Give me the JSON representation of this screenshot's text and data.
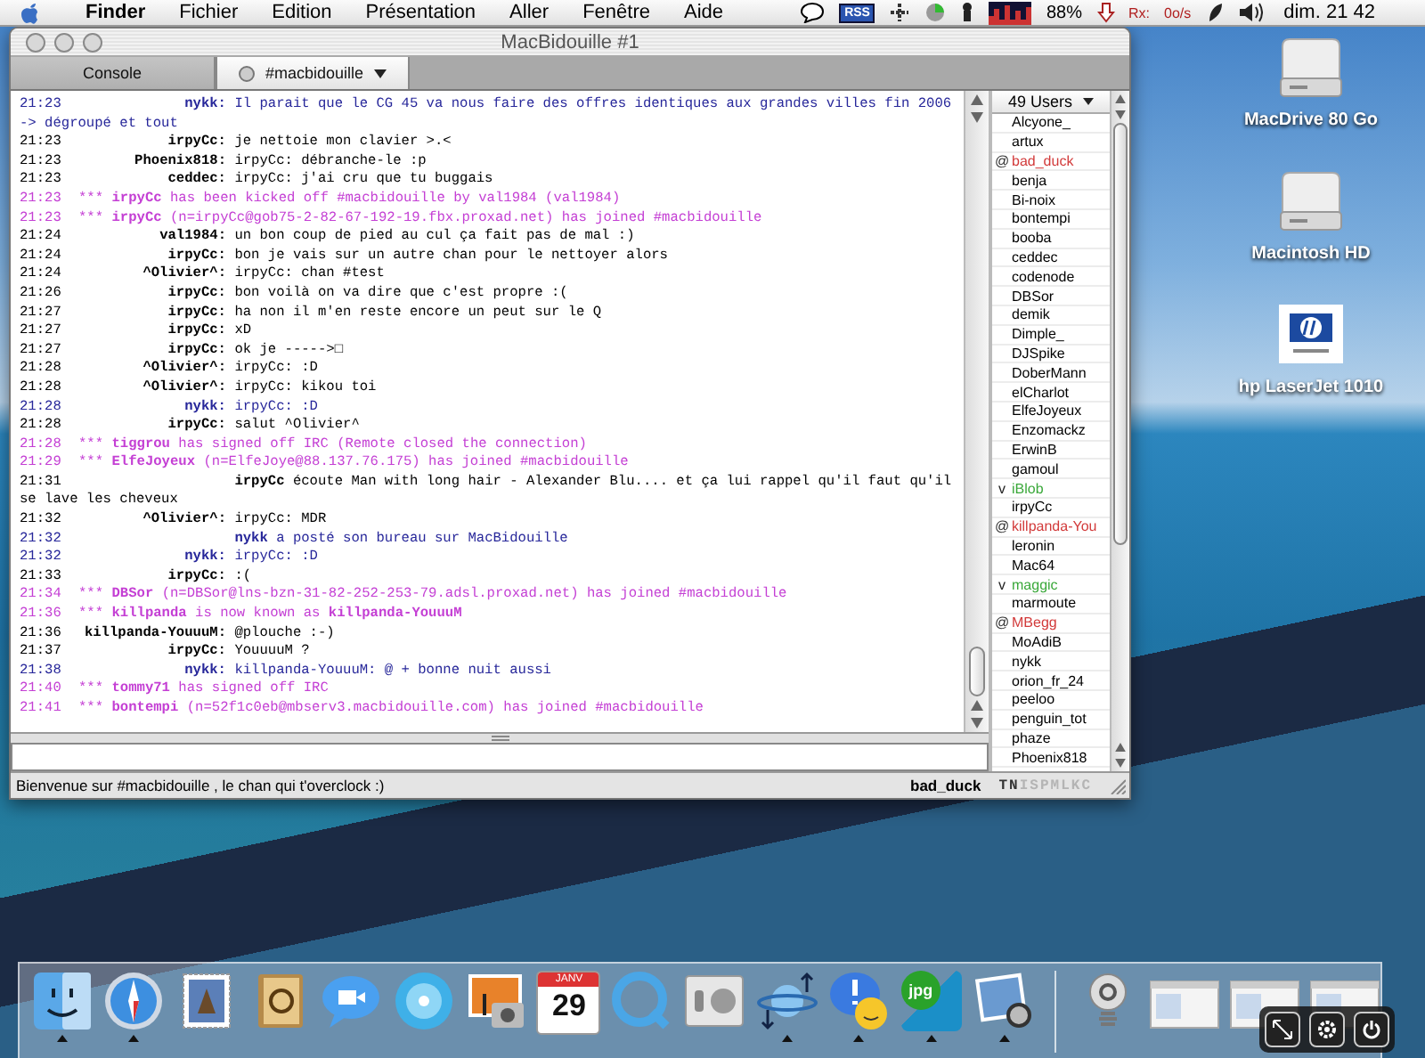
{
  "menu_bar": {
    "menus": [
      "Finder",
      "Fichier",
      "Edition",
      "Présentation",
      "Aller",
      "Fenêtre",
      "Aide"
    ],
    "rss": "RSS",
    "battery": "88%",
    "net_label": "Rx:",
    "net_rate": "0o/s",
    "clock": "dim. 21 42"
  },
  "window": {
    "title": "MacBidouille #1",
    "tabs": [
      {
        "label": "Console",
        "selected": false
      },
      {
        "label": "#macbidouille",
        "selected": true
      }
    ],
    "chat": [
      {
        "kind": "message",
        "time": "21:23",
        "nick": "nykk:",
        "text": "Il parait que le CG 45 va nous faire des offres identiques aux grandes villes fin 2006 -> dégroupé et tout",
        "color": "#27279a"
      },
      {
        "kind": "message",
        "time": "21:23",
        "nick": "irpyCc:",
        "text": "je nettoie mon clavier >.<",
        "color": "#000000"
      },
      {
        "kind": "message",
        "time": "21:23",
        "nick": "Phoenix818:",
        "text": "irpyCc: débranche-le :p",
        "color": "#000000"
      },
      {
        "kind": "message",
        "time": "21:23",
        "nick": "ceddec:",
        "text": "irpyCc: j'ai cru que tu buggais",
        "color": "#000000"
      },
      {
        "kind": "event",
        "time": "21:23",
        "marker": "***",
        "text": "**irpyCc** has been kicked off #macbidouille by val1984 (val1984)",
        "color": "#c43fd4"
      },
      {
        "kind": "event",
        "time": "21:23",
        "marker": "***",
        "text": "**irpyCc** (n=irpyCc@gob75-2-82-67-192-19.fbx.proxad.net) has joined #macbidouille",
        "color": "#c43fd4"
      },
      {
        "kind": "message",
        "time": "21:24",
        "nick": "val1984:",
        "text": "un bon coup de pied au cul ça fait pas de mal :)",
        "color": "#000000"
      },
      {
        "kind": "message",
        "time": "21:24",
        "nick": "irpyCc:",
        "text": "bon je vais sur un autre chan pour le nettoyer alors",
        "color": "#000000"
      },
      {
        "kind": "message",
        "time": "21:24",
        "nick": "^Olivier^:",
        "text": "irpyCc: chan #test",
        "color": "#000000"
      },
      {
        "kind": "message",
        "time": "21:26",
        "nick": "irpyCc:",
        "text": "bon voilà on va dire que c'est propre :(",
        "color": "#000000"
      },
      {
        "kind": "message",
        "time": "21:27",
        "nick": "irpyCc:",
        "text": "ha non il m'en reste encore un peut sur le Q",
        "color": "#000000"
      },
      {
        "kind": "message",
        "time": "21:27",
        "nick": "irpyCc:",
        "text": "xD",
        "color": "#000000"
      },
      {
        "kind": "message",
        "time": "21:27",
        "nick": "irpyCc:",
        "text": "ok je ----->□",
        "color": "#000000"
      },
      {
        "kind": "message",
        "time": "21:28",
        "nick": "^Olivier^:",
        "text": "irpyCc: :D",
        "color": "#000000"
      },
      {
        "kind": "message",
        "time": "21:28",
        "nick": "^Olivier^:",
        "text": "irpyCc: kikou toi",
        "color": "#000000"
      },
      {
        "kind": "message",
        "time": "21:28",
        "nick": "nykk:",
        "text": "irpyCc: :D",
        "color": "#27279a"
      },
      {
        "kind": "message",
        "time": "21:28",
        "nick": "irpyCc:",
        "text": "salut ^Olivier^",
        "color": "#000000"
      },
      {
        "kind": "event",
        "time": "21:28",
        "marker": "***",
        "text": "**tiggrou** has signed off IRC (Remote closed the connection)",
        "color": "#c43fd4"
      },
      {
        "kind": "event",
        "time": "21:29",
        "marker": "***",
        "text": "**ElfeJoyeux** (n=ElfeJoye@88.137.76.175) has joined #macbidouille",
        "color": "#c43fd4"
      },
      {
        "kind": "action",
        "time": "21:31",
        "nick": "irpyCc",
        "text": "écoute Man with long hair - Alexander Blu.... et ça lui rappel qu'il faut qu'il se lave les cheveux",
        "color": "#000000"
      },
      {
        "kind": "message",
        "time": "21:32",
        "nick": "^Olivier^:",
        "text": "irpyCc: MDR",
        "color": "#000000"
      },
      {
        "kind": "action",
        "time": "21:32",
        "nick": "nykk",
        "text": "a posté son bureau sur MacBidouille",
        "color": "#27279a"
      },
      {
        "kind": "message",
        "time": "21:32",
        "nick": "nykk:",
        "text": "irpyCc: :D",
        "color": "#27279a"
      },
      {
        "kind": "message",
        "time": "21:33",
        "nick": "irpyCc:",
        "text": ":(",
        "color": "#000000"
      },
      {
        "kind": "event",
        "time": "21:34",
        "marker": "***",
        "text": "**DBSor** (n=DBSor@lns-bzn-31-82-252-253-79.adsl.proxad.net) has joined #macbidouille",
        "color": "#c43fd4"
      },
      {
        "kind": "event",
        "time": "21:36",
        "marker": "***",
        "text": "**killpanda** is now known as **killpanda-YouuuM**",
        "color": "#c43fd4"
      },
      {
        "kind": "message",
        "time": "21:36",
        "nick": "killpanda-YouuuM:",
        "text": "@plouche :-)",
        "color": "#000000"
      },
      {
        "kind": "message",
        "time": "21:37",
        "nick": "irpyCc:",
        "text": "YouuuuM ?",
        "color": "#000000"
      },
      {
        "kind": "message",
        "time": "21:38",
        "nick": "nykk:",
        "text": "killpanda-YouuuM: @ + bonne nuit aussi",
        "color": "#27279a"
      },
      {
        "kind": "event",
        "time": "21:40",
        "marker": "***",
        "text": "**tommy71** has signed off IRC",
        "color": "#c43fd4"
      },
      {
        "kind": "event",
        "time": "21:41",
        "marker": "***",
        "text": "**bontempi** (n=52f1c0eb@mbserv3.macbidouille.com) has joined #macbidouille",
        "color": "#c43fd4"
      }
    ],
    "users": {
      "header": "49 Users",
      "items": [
        {
          "name": "Alcyone_",
          "color": "#000000"
        },
        {
          "name": "artux",
          "color": "#000000"
        },
        {
          "name": "bad_duck",
          "prefix": "@",
          "color": "#d23a3a"
        },
        {
          "name": "benja",
          "color": "#000000"
        },
        {
          "name": "Bi-noix",
          "color": "#000000"
        },
        {
          "name": "bontempi",
          "color": "#000000"
        },
        {
          "name": "booba",
          "color": "#000000"
        },
        {
          "name": "ceddec",
          "color": "#000000"
        },
        {
          "name": "codenode",
          "color": "#000000"
        },
        {
          "name": "DBSor",
          "color": "#000000"
        },
        {
          "name": "demik",
          "color": "#000000"
        },
        {
          "name": "Dimple_",
          "color": "#000000"
        },
        {
          "name": "DJSpike",
          "color": "#000000"
        },
        {
          "name": "DoberMann",
          "color": "#000000"
        },
        {
          "name": "elCharlot",
          "color": "#000000"
        },
        {
          "name": "ElfeJoyeux",
          "color": "#000000"
        },
        {
          "name": "Enzomackz",
          "color": "#000000"
        },
        {
          "name": "ErwinB",
          "color": "#000000"
        },
        {
          "name": "gamoul",
          "color": "#000000"
        },
        {
          "name": "iBlob",
          "prefix": "v",
          "color": "#3aa83a"
        },
        {
          "name": "irpyCc",
          "color": "#000000"
        },
        {
          "name": "killpanda-You",
          "prefix": "@",
          "color": "#d23a3a"
        },
        {
          "name": "leronin",
          "color": "#000000"
        },
        {
          "name": "Mac64",
          "color": "#000000"
        },
        {
          "name": "maggic",
          "prefix": "v",
          "color": "#3aa83a"
        },
        {
          "name": "marmoute",
          "color": "#000000"
        },
        {
          "name": "MBegg",
          "prefix": "@",
          "color": "#d23a3a"
        },
        {
          "name": "MoAdiB",
          "color": "#000000"
        },
        {
          "name": "nykk",
          "color": "#000000"
        },
        {
          "name": "orion_fr_24",
          "color": "#000000"
        },
        {
          "name": "peeloo",
          "color": "#000000"
        },
        {
          "name": "penguin_tot",
          "color": "#000000"
        },
        {
          "name": "phaze",
          "color": "#000000"
        },
        {
          "name": "Phoenix818",
          "color": "#000000"
        }
      ]
    },
    "topic": "Bienvenue sur #macbidouille , le chan qui t'overclock :)",
    "nick": "bad_duck",
    "modes": [
      {
        "letter": "T",
        "on": true
      },
      {
        "letter": "N",
        "on": true
      },
      {
        "letter": "I",
        "on": false
      },
      {
        "letter": "S",
        "on": false
      },
      {
        "letter": "P",
        "on": false
      },
      {
        "letter": "M",
        "on": false
      },
      {
        "letter": "L",
        "on": false
      },
      {
        "letter": "K",
        "on": false
      },
      {
        "letter": "C",
        "on": false
      }
    ]
  },
  "desktop_icons": [
    {
      "kind": "drive",
      "label": "MacDrive 80 Go"
    },
    {
      "kind": "drive",
      "label": "Macintosh HD"
    },
    {
      "kind": "printer",
      "label": "hp LaserJet 1010"
    }
  ],
  "dock": {
    "items": [
      {
        "kind": "finder",
        "running": true
      },
      {
        "kind": "compass",
        "running": true
      },
      {
        "kind": "stamp",
        "running": false
      },
      {
        "kind": "addressbook",
        "running": false
      },
      {
        "kind": "videochat",
        "running": false
      },
      {
        "kind": "cd",
        "running": false
      },
      {
        "kind": "photo",
        "running": false
      },
      {
        "kind": "calendar",
        "month": "JANV",
        "day": "29",
        "running": false
      },
      {
        "kind": "quicktime",
        "running": false
      },
      {
        "kind": "switch",
        "running": false
      },
      {
        "kind": "planet",
        "running": true
      },
      {
        "kind": "alert",
        "running": true
      },
      {
        "kind": "jpg",
        "label": "jpg",
        "running": true
      },
      {
        "kind": "magnifier",
        "running": true
      },
      {
        "kind": "separator"
      },
      {
        "kind": "spring",
        "running": false
      },
      {
        "kind": "thumbnail",
        "running": false
      },
      {
        "kind": "thumbnail",
        "running": false
      },
      {
        "kind": "thumbnail",
        "running": false
      }
    ]
  }
}
